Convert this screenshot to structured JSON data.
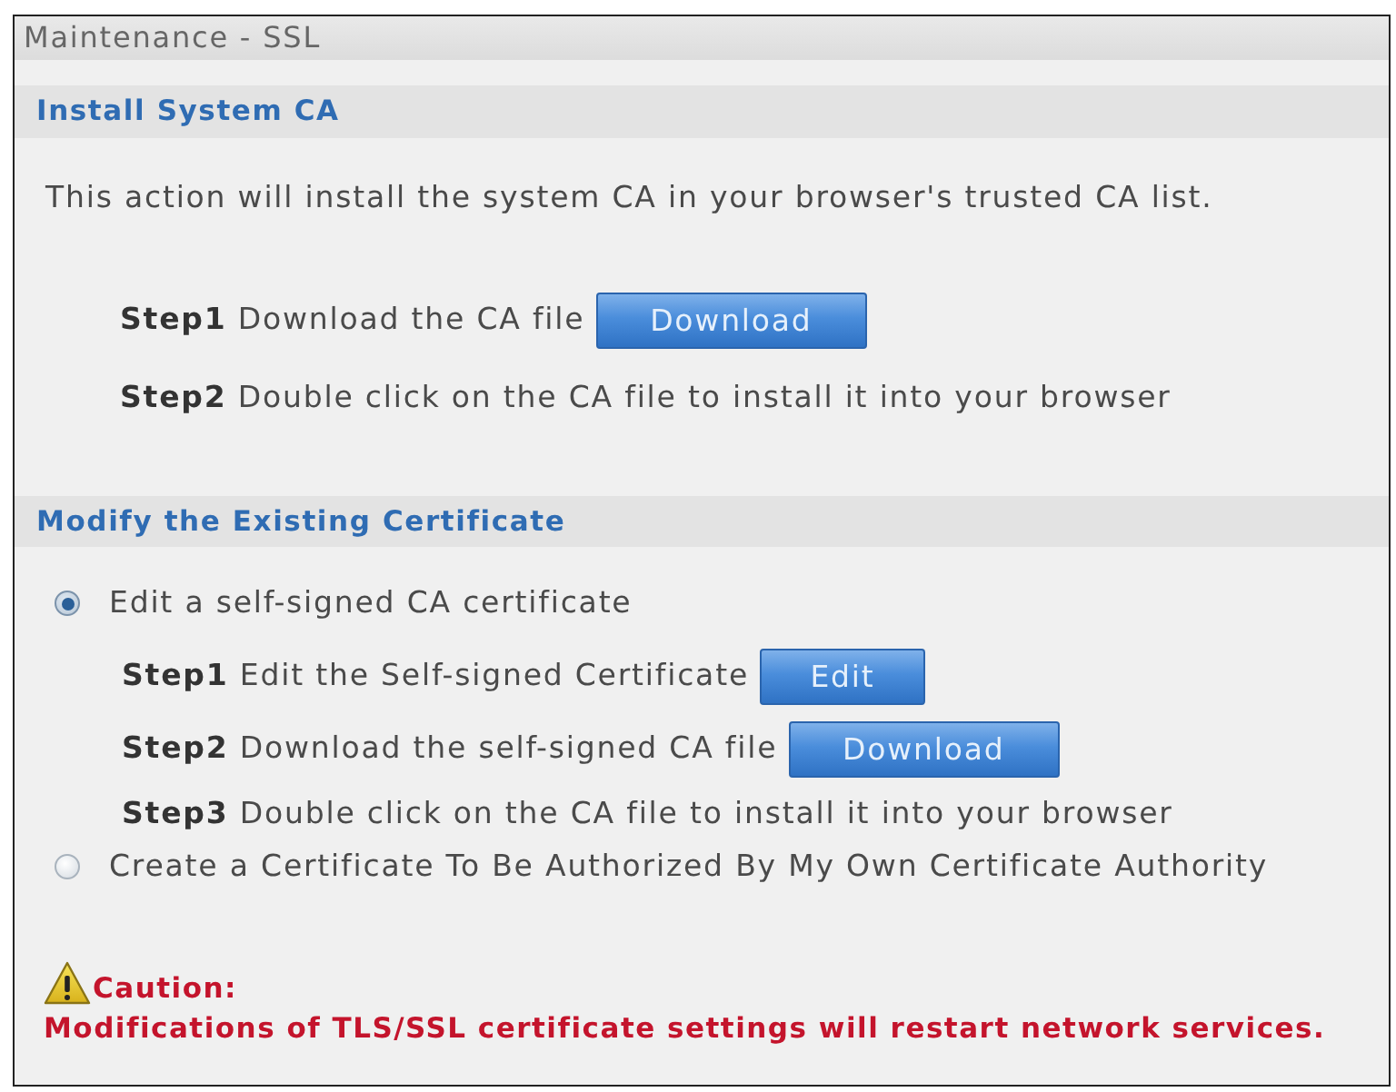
{
  "window": {
    "title": "Maintenance - SSL"
  },
  "sections": [
    {
      "title": "Install System CA",
      "description": "This action will install the system CA in your browser's trusted CA list.",
      "steps": [
        {
          "text": "**Step1** Download the CA file",
          "button": "Download"
        },
        {
          "text": "**Step2** Double click on the CA file to install it into your browser"
        }
      ]
    },
    {
      "title": "Modify the Existing Certificate",
      "options": [
        {
          "label": "Edit a self-signed CA certificate",
          "selected": true,
          "steps": [
            {
              "text": "**Step1** Edit the Self-signed Certificate",
              "button": "Edit"
            },
            {
              "text": "**Step2** Download the self-signed CA file",
              "button": "Download"
            },
            {
              "text": "**Step3** Double click on the CA file to install it into your browser"
            }
          ]
        },
        {
          "label": "Create a Certificate To Be Authorized By My Own Certificate Authority",
          "selected": false
        }
      ]
    }
  ],
  "caution": {
    "title": "Caution:",
    "message": "Modifications of TLS/SSL certificate settings will restart network services."
  }
}
